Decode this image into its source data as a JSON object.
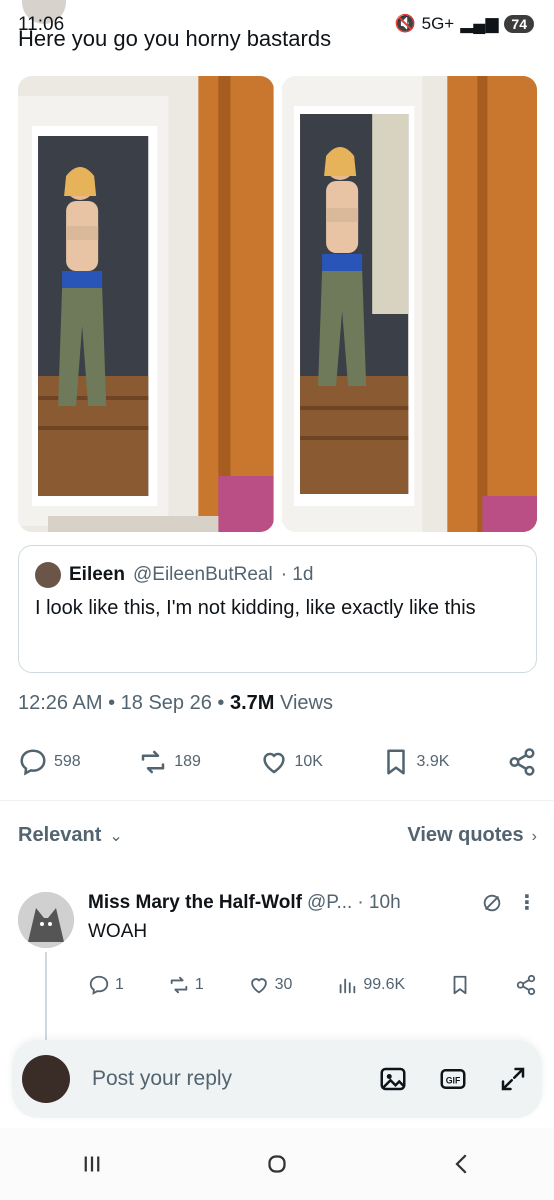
{
  "status": {
    "time": "11:06",
    "network": "5G+",
    "battery": "74"
  },
  "tweet": {
    "text": "Here you go you horny bastards",
    "quote": {
      "name": "Eileen",
      "handle": "@EileenButReal",
      "age": "· 1d",
      "text": "I look like this, I'm not kidding, like exactly like this"
    },
    "meta": {
      "time": "12:26 AM",
      "sep1": " • ",
      "date": "18 Sep 26",
      "sep2": " • ",
      "views": "3.7M",
      "views_label": " Views"
    },
    "actions": {
      "replies": "598",
      "reposts": "189",
      "likes": "10K",
      "bookmarks": "3.9K"
    }
  },
  "filter": {
    "sort_label": "Relevant",
    "view_quotes": "View quotes"
  },
  "reply": {
    "name": "Miss Mary the Half-Wolf",
    "handle": "@P...",
    "age": "· 10h",
    "text": "WOAH",
    "replies": "1",
    "reposts": "1",
    "likes": "30",
    "views": "99.6K"
  },
  "composer": {
    "placeholder": "Post your reply"
  },
  "colors": {
    "text": "#0f1419",
    "muted": "#536471",
    "border": "#cfd9de"
  }
}
